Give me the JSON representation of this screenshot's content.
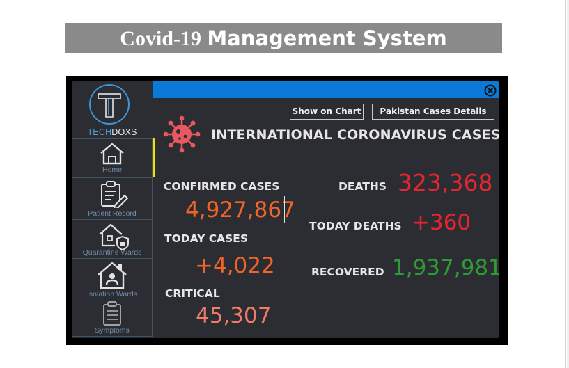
{
  "page": {
    "title_part1": "Covid-19",
    "title_part2": "Management System"
  },
  "sidebar": {
    "logo_text_accent": "TECH",
    "logo_text_rest": "DOXS",
    "items": [
      {
        "label": "Home",
        "icon": "home-icon"
      },
      {
        "label": "Patient Record",
        "icon": "clipboard-icon"
      },
      {
        "label": "Quarantine Wards",
        "icon": "house-shield-icon"
      },
      {
        "label": "Isolation Wards",
        "icon": "house-person-icon"
      },
      {
        "label": "Symptoms",
        "icon": "checklist-icon"
      }
    ]
  },
  "toolbar": {
    "show_chart_label": "Show on Chart",
    "pakistan_label": "Pakistan Cases Details"
  },
  "main": {
    "heading": "INTERNATIONAL CORONAVIRUS CASES",
    "confirmed_label": "CONFIRMED CASES",
    "confirmed_value": "4,927,867",
    "today_cases_label": "TODAY CASES",
    "today_cases_value": "+4,022",
    "critical_label": "CRITICAL",
    "critical_value": "45,307",
    "deaths_label": "DEATHS",
    "deaths_value": "323,368",
    "today_deaths_label": "TODAY DEATHS",
    "today_deaths_value": "+360",
    "recovered_label": "RECOVERED",
    "recovered_value": "1,937,981"
  },
  "colors": {
    "accent_blue": "#0a79d8",
    "orange": "#f0642a",
    "salmon": "#f27b6a",
    "red": "#e5262f",
    "green": "#2f9b35",
    "active_indicator": "#f1e000"
  }
}
